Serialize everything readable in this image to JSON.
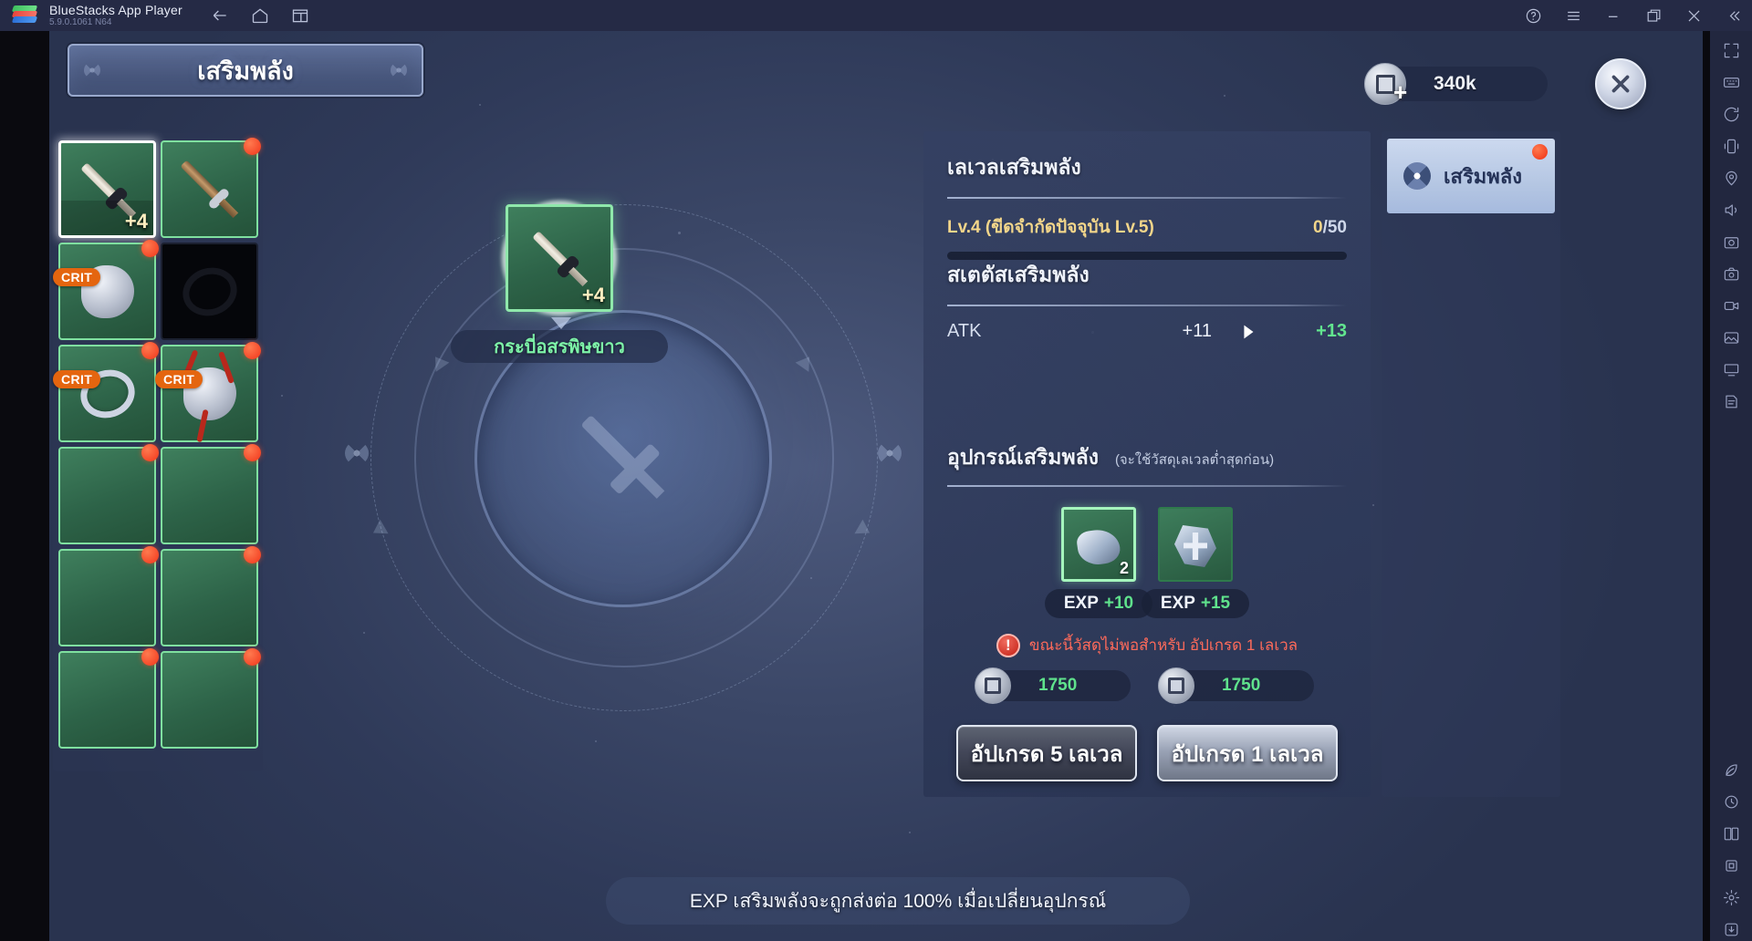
{
  "bluestacks": {
    "app_title": "BlueStacks App Player",
    "version": "5.9.0.1061  N64",
    "nav": [
      {
        "name": "back-icon",
        "label": "Back"
      },
      {
        "name": "home-icon",
        "label": "Home"
      },
      {
        "name": "multi-instance-icon",
        "label": "Multi-instance"
      }
    ],
    "window_controls": [
      {
        "name": "help-icon",
        "label": "Help"
      },
      {
        "name": "menu-icon",
        "label": "Menu"
      },
      {
        "name": "minimize-icon",
        "label": "Minimize"
      },
      {
        "name": "maximize-icon",
        "label": "Maximize"
      },
      {
        "name": "close-icon",
        "label": "Close"
      },
      {
        "name": "collapse-sidebar-icon",
        "label": "Collapse"
      }
    ],
    "sidebar_icons": [
      "fullscreen-icon",
      "keyboard-controls-icon",
      "rotate-icon",
      "shake-icon",
      "location-icon",
      "volume-icon",
      "screenshot-icon",
      "camera-icon",
      "video-record-icon",
      "gallery-icon",
      "copy-to-pc-icon",
      "script-icon",
      "eco-mode-icon",
      "macro-icon",
      "multi-instance-sync-icon",
      "trim-memory-icon",
      "settings-icon",
      "apk-install-icon"
    ]
  },
  "game": {
    "header": {
      "title": "เสริมพลัง",
      "currency": {
        "value": "340k",
        "icon": "silver-coin-icon",
        "add_label": "+"
      },
      "close_label": "✕"
    },
    "equipment": {
      "slots": [
        {
          "name": "weapon-sword-white-viper",
          "type": "sword",
          "art": "sword",
          "selected": true,
          "dot": false,
          "badge": "",
          "enhance": "+4",
          "empty": false
        },
        {
          "name": "weapon-spear",
          "type": "sword",
          "art": "sword2",
          "selected": false,
          "dot": true,
          "badge": "",
          "enhance": "",
          "empty": false
        },
        {
          "name": "necklace",
          "type": "accessory",
          "art": "blob",
          "selected": false,
          "dot": true,
          "badge": "CRIT",
          "enhance": "",
          "empty": false
        },
        {
          "name": "ring-empty-slot",
          "type": "accessory",
          "art": "ring-dark",
          "selected": false,
          "dot": false,
          "badge": "",
          "enhance": "",
          "empty": true
        },
        {
          "name": "ring-silver",
          "type": "accessory",
          "art": "ring",
          "selected": false,
          "dot": true,
          "badge": "CRIT",
          "enhance": "",
          "empty": false
        },
        {
          "name": "pendant-ornament",
          "type": "accessory",
          "art": "blob-ribbon",
          "selected": false,
          "dot": true,
          "badge": "CRIT",
          "enhance": "",
          "empty": false
        },
        {
          "name": "helmet-hair",
          "type": "armor",
          "art": "cloth-h1",
          "selected": false,
          "dot": true,
          "badge": "",
          "enhance": "",
          "empty": false
        },
        {
          "name": "chest-armor",
          "type": "armor",
          "art": "cloth-h2",
          "selected": false,
          "dot": true,
          "badge": "",
          "enhance": "",
          "empty": false
        },
        {
          "name": "robe-armor",
          "type": "armor",
          "art": "cloth-h3",
          "selected": false,
          "dot": true,
          "badge": "",
          "enhance": "",
          "empty": false
        },
        {
          "name": "gloves-armor",
          "type": "armor",
          "art": "cloth-h4",
          "selected": false,
          "dot": true,
          "badge": "",
          "enhance": "",
          "empty": false
        },
        {
          "name": "belt-armor",
          "type": "armor",
          "art": "cloth-h5",
          "selected": false,
          "dot": true,
          "badge": "",
          "enhance": "",
          "empty": false
        },
        {
          "name": "boots-armor",
          "type": "armor",
          "art": "cloth-h6",
          "selected": false,
          "dot": true,
          "badge": "",
          "enhance": "",
          "empty": false
        }
      ]
    },
    "focus": {
      "item_name": "กระบี่อสรพิษขาว",
      "enhance": "+4"
    },
    "info_bar": "EXP เสริมพลังจะถูกส่งต่อ 100% เมื่อเปลี่ยนอุปกรณ์",
    "detail": {
      "level_section": {
        "title": "เลเวลเสริมพลัง",
        "level_text": "Lv.4 (ขีดจำกัดปัจจุบัน Lv.5)",
        "exp_current": "0",
        "exp_separator": "/",
        "exp_max": "50",
        "progress_percent": 0
      },
      "stat_section": {
        "title": "สเตตัสเสริมพลัง",
        "rows": [
          {
            "name": "ATK",
            "from": "+11",
            "arrow": "▶",
            "to": "+13"
          }
        ]
      },
      "material_section": {
        "title": "อุปกรณ์เสริมพลัง",
        "note": "(จะใช้วัสดุเลเวลต่ำสุดก่อน)",
        "materials": [
          {
            "name": "enhance-stone-low",
            "count": "2",
            "exp_label": "EXP",
            "exp_value": "+10",
            "active": true
          },
          {
            "name": "enhance-stone-high",
            "count": "",
            "exp_label": "EXP",
            "exp_value": "+15",
            "active": false
          }
        ],
        "warning": {
          "icon": "!",
          "text": "ขณะนี้วัสดุไม่พอสำหรับ อัปเกรด 1 เลเวล"
        },
        "costs": [
          {
            "name": "cost-upgrade-5",
            "icon": "silver-coin-icon",
            "value": "1750"
          },
          {
            "name": "cost-upgrade-1",
            "icon": "silver-coin-icon",
            "value": "1750"
          }
        ]
      },
      "buttons": [
        {
          "name": "upgrade-5-levels-button",
          "label": "อัปเกรด 5 เลเวล",
          "bright": false
        },
        {
          "name": "upgrade-1-level-button",
          "label": "อัปเกรด 1 เลเวล",
          "bright": true
        }
      ]
    },
    "tabs": [
      {
        "name": "tab-enhance",
        "label": "เสริมพลัง",
        "icon": "enhance-icon",
        "dot": true,
        "selected": true
      }
    ]
  },
  "colors": {
    "accent_green": "#62e58f",
    "accent_gold": "#f3d68a",
    "warning_red": "#ff6a5a",
    "badge_orange": "#e4650f",
    "rarity_green": "#7fe0a0"
  }
}
